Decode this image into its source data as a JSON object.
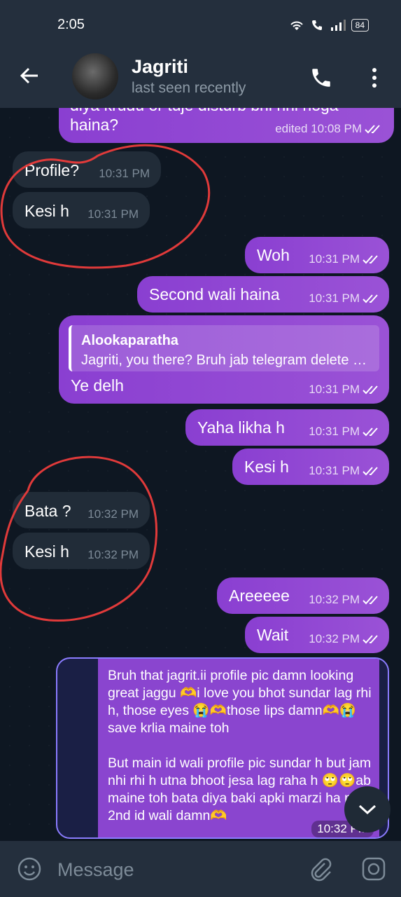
{
  "status_bar": {
    "time": "2:05",
    "battery": "84"
  },
  "header": {
    "title": "Jagriti",
    "subtitle": "last seen recently"
  },
  "messages": [
    {
      "dir": "out",
      "text": "diya krudu or tuje disturb bhi nhi hoga\nhaina?",
      "time": "edited 10:08 PM"
    },
    {
      "dir": "in",
      "text": "Profile?",
      "time": "10:31 PM"
    },
    {
      "dir": "in",
      "text": "Kesi h",
      "time": "10:31 PM"
    },
    {
      "dir": "out",
      "text": "Woh",
      "time": "10:31 PM"
    },
    {
      "dir": "out",
      "text": "Second wali haina",
      "time": "10:31 PM"
    },
    {
      "dir": "out",
      "reply_name": "Alookaparatha",
      "reply_text": "Jagriti, you there?  Bruh jab telegram delete kiya",
      "text": "Ye delh",
      "time": "10:31 PM"
    },
    {
      "dir": "out",
      "text": "Yaha likha h",
      "time": "10:31 PM"
    },
    {
      "dir": "out",
      "text": "Kesi h",
      "time": "10:31 PM"
    },
    {
      "dir": "in",
      "text": "Bata ?",
      "time": "10:32 PM"
    },
    {
      "dir": "in",
      "text": "Kesi h",
      "time": "10:32 PM"
    },
    {
      "dir": "out",
      "text": "Areeeee",
      "time": "10:32 PM"
    },
    {
      "dir": "out",
      "text": "Wait",
      "time": "10:32 PM"
    }
  ],
  "forwarded": {
    "text": "Bruh that jagrit.ii profile pic damn looking great jaggu 🫶i love you bhot sundar lag rhi h, those eyes 😭🫶those lips damn🫶😭save krlia maine toh\n\nBut main id wali profile pic sundar h but jam nhi rhi h utna bhoot jesa lag raha h 🙄🙄ab maine toh bata diya baki apki marzi ha pr 2nd id wali damn🫶",
    "time": "10:32 PM"
  },
  "input": {
    "placeholder": "Message"
  },
  "colors": {
    "outgoing": "#9a4fd6",
    "incoming": "#212c38",
    "header": "#242f3d",
    "annotation": "#e03a3a"
  }
}
